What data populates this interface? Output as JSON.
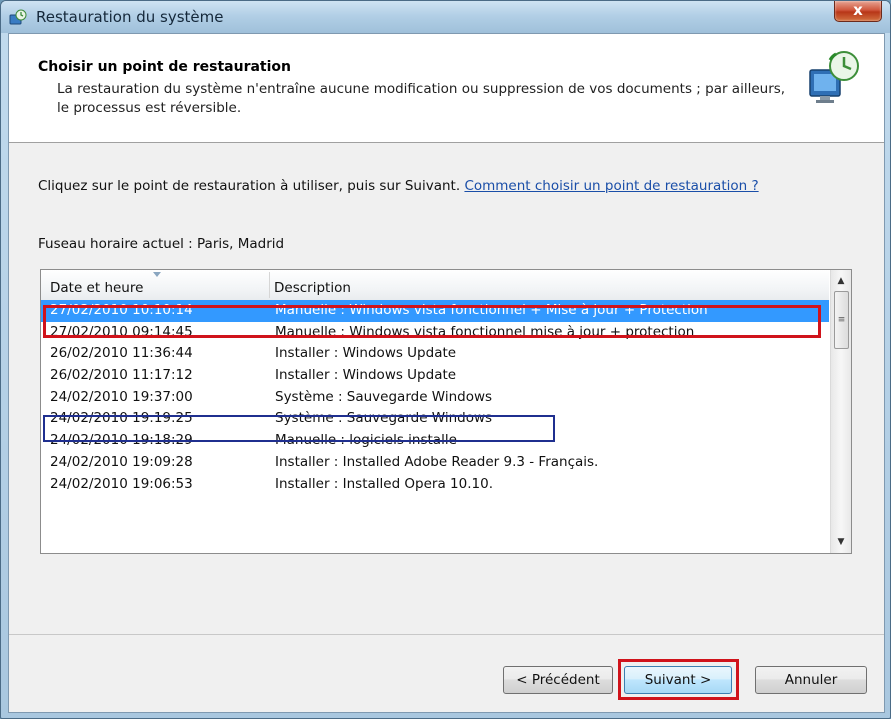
{
  "window": {
    "title": "Restauration du système",
    "close_label": "x"
  },
  "header": {
    "title": "Choisir un point de restauration",
    "description": "La restauration du système n'entraîne aucune modification ou suppression de vos documents ; par ailleurs, le processus est réversible."
  },
  "instructions": {
    "text": "Cliquez sur le point de restauration à utiliser, puis sur Suivant. ",
    "link": "Comment choisir un point de restauration ?"
  },
  "timezone": "Fuseau horaire actuel : Paris, Madrid",
  "list": {
    "columns": [
      "Date et heure",
      "Description"
    ],
    "rows": [
      {
        "date": "27/02/2010 10:10:14",
        "description": "Manuelle : Windows vista fonctionnel + Mise à jour + Protection",
        "selected": true
      },
      {
        "date": "27/02/2010 09:14:45",
        "description": "Manuelle : Windows vista fonctionnel mise à jour + protection"
      },
      {
        "date": "26/02/2010 11:36:44",
        "description": "Installer : Windows Update"
      },
      {
        "date": "26/02/2010 11:17:12",
        "description": "Installer : Windows Update"
      },
      {
        "date": "24/02/2010 19:37:00",
        "description": "Système : Sauvegarde Windows"
      },
      {
        "date": "24/02/2010 19:19:25",
        "description": "Système : Sauvegarde Windows"
      },
      {
        "date": "24/02/2010 19:18:29",
        "description": "Manuelle : logiciels installe"
      },
      {
        "date": "24/02/2010 19:09:28",
        "description": "Installer : Installed Adobe Reader 9.3 - Français."
      },
      {
        "date": "24/02/2010 19:06:53",
        "description": "Installer : Installed Opera 10.10."
      }
    ]
  },
  "buttons": {
    "previous": "< Précédent",
    "next": "Suivant >",
    "cancel": "Annuler"
  },
  "colors": {
    "selection": "#3399ff",
    "highlight_red": "#d0131b",
    "highlight_blue": "#1f2f8f",
    "link": "#1a4ea8"
  }
}
